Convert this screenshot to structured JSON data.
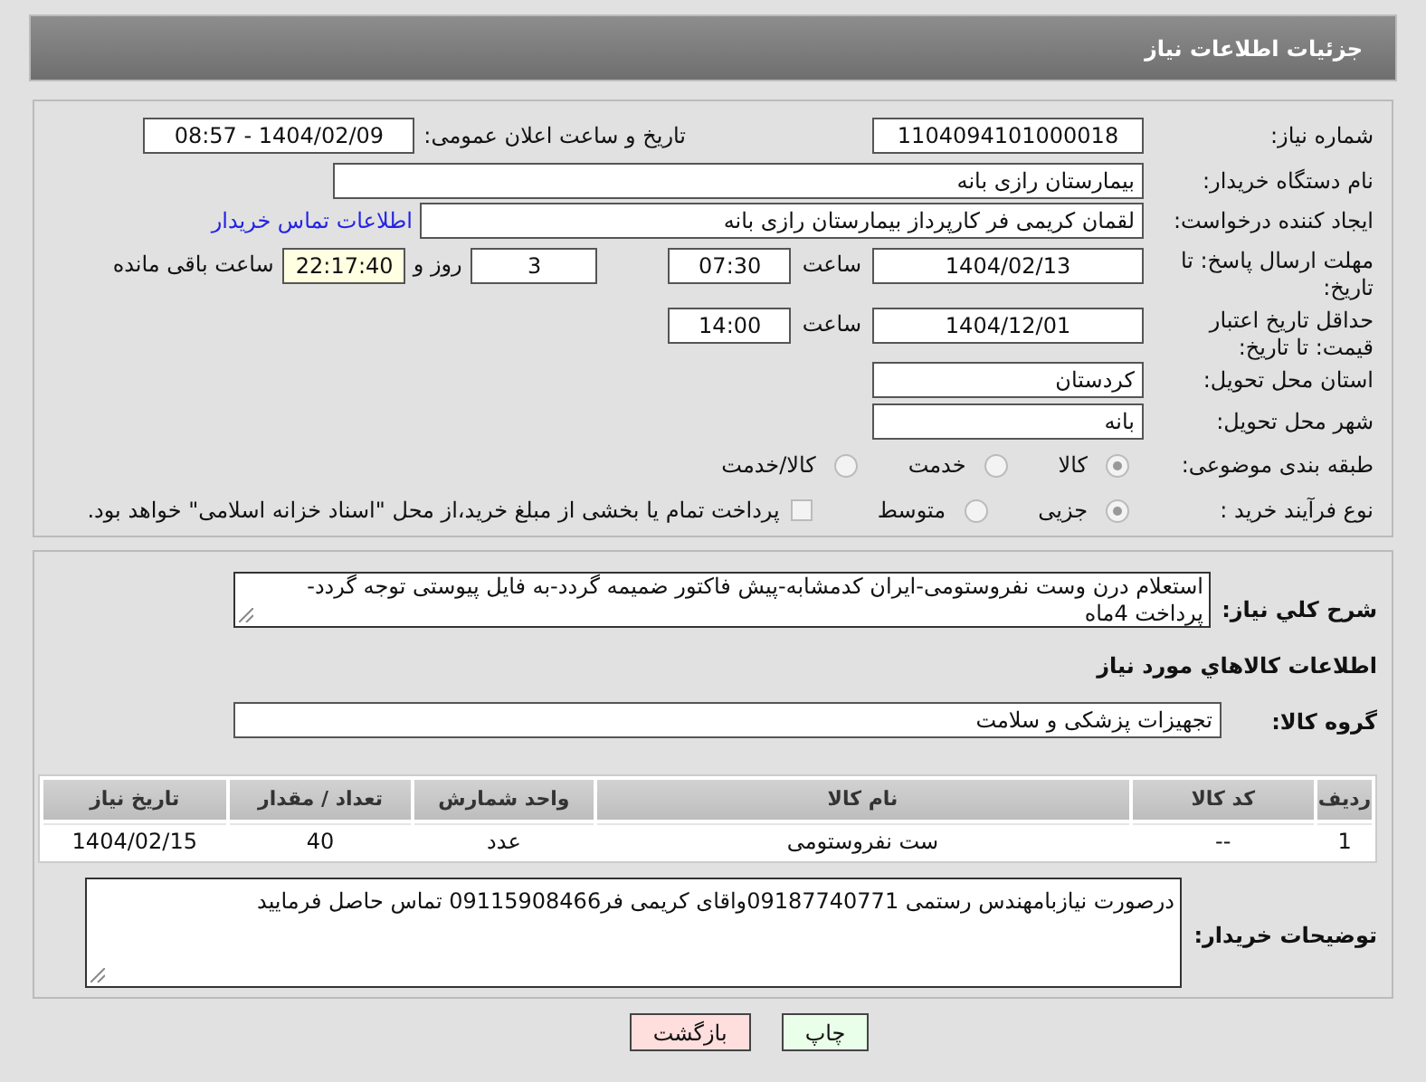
{
  "header": {
    "title": "جزئیات اطلاعات نیاز"
  },
  "need": {
    "need_number": {
      "label": "شماره نیاز:",
      "value": "1104094101000018"
    },
    "announce": {
      "label": "تاریخ و ساعت اعلان عمومی:",
      "value": "1404/02/09 - 08:57"
    },
    "buyer_org": {
      "label": "نام دستگاه خریدار:",
      "value": "بیمارستان رازی بانه"
    },
    "requester": {
      "label": "ایجاد کننده درخواست:",
      "value": "لقمان کریمی فر کارپرداز بیمارستان رازی بانه",
      "link": "اطلاعات تماس خریدار"
    },
    "deadline": {
      "label": "مهلت ارسال پاسخ: تا تاریخ:",
      "date": "1404/02/13",
      "time_label": "ساعت",
      "time": "07:30",
      "days": "3",
      "days_label": "روز و",
      "remaining": "22:17:40",
      "remaining_label": "ساعت باقی مانده"
    },
    "validity": {
      "label": "حداقل تاریخ اعتبار قیمت: تا تاریخ:",
      "date": "1404/12/01",
      "time_label": "ساعت",
      "time": "14:00"
    },
    "province": {
      "label": "استان محل تحویل:",
      "value": "کردستان"
    },
    "city": {
      "label": "شهر محل تحویل:",
      "value": "بانه"
    },
    "category": {
      "label": "طبقه بندی موضوعی:",
      "options": [
        {
          "label": "کالا",
          "selected": true
        },
        {
          "label": "خدمت",
          "selected": false
        },
        {
          "label": "کالا/خدمت",
          "selected": false
        }
      ]
    },
    "process": {
      "label": "نوع فرآیند خرید :",
      "options": [
        {
          "label": "جزیی",
          "selected": true
        },
        {
          "label": "متوسط",
          "selected": false
        }
      ],
      "payment": {
        "label": "پرداخت تمام یا بخشی از مبلغ خرید،از محل \"اسناد خزانه اسلامی\" خواهد بود.",
        "checked": false
      }
    }
  },
  "details": {
    "summary": {
      "label": "شرح كلي نياز:",
      "value": "استعلام درن وست نفروستومی-ایران کدمشابه-پیش فاکتور ضمیمه گردد-به فایل پیوستی توجه گردد-پرداخت 4ماه"
    },
    "goods_heading": "اطلاعات كالاهاي مورد نياز",
    "goods_group": {
      "label": "گروه کالا:",
      "value": "تجهیزات پزشکی و سلامت"
    },
    "table": {
      "columns": [
        "ردیف",
        "کد کالا",
        "نام کالا",
        "واحد شمارش",
        "تعداد / مقدار",
        "تاریخ نیاز"
      ],
      "rows": [
        [
          "1",
          "--",
          "ست نفروستومی",
          "عدد",
          "40",
          "1404/02/15"
        ]
      ]
    },
    "buyer_notes": {
      "label": "توضیحات خریدار:",
      "value": "درصورت نیازبامهندس رستمی 09187740771واقای کریمی فر09115908466 تماس حاصل فرمایید"
    }
  },
  "buttons": [
    {
      "label": "چاپ",
      "kind": "print"
    },
    {
      "label": "بازگشت",
      "kind": "back"
    }
  ]
}
